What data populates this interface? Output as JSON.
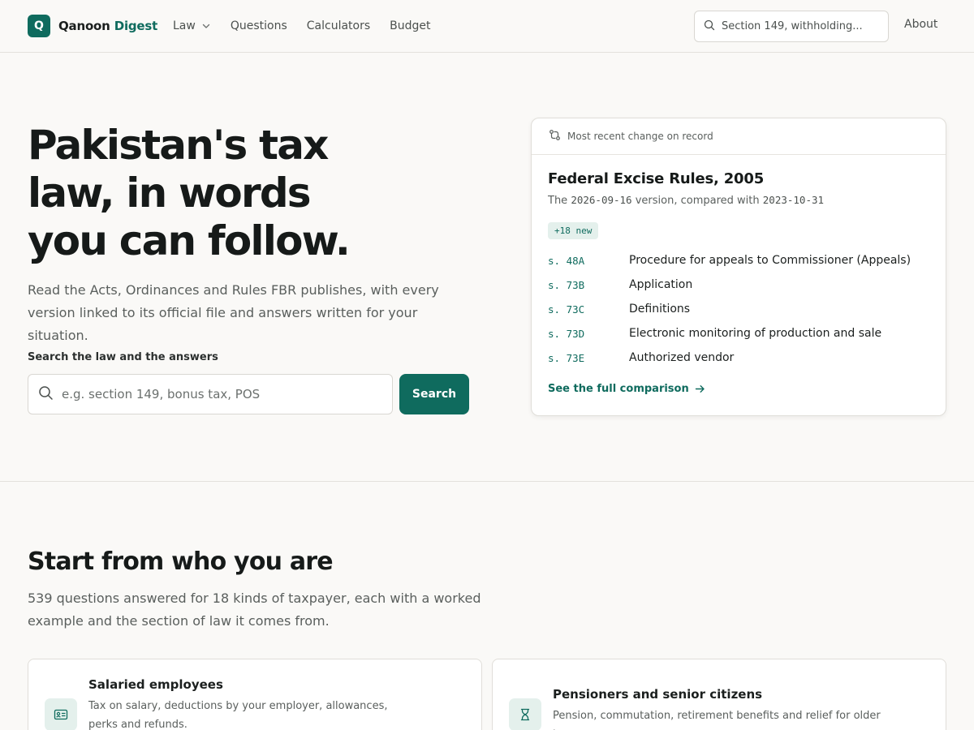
{
  "header": {
    "logo_mark": "Q",
    "logo_word_1": "Qanoon",
    "logo_word_2": "Digest",
    "nav": [
      {
        "label": "Law",
        "has_dropdown": true
      },
      {
        "label": "Questions"
      },
      {
        "label": "Calculators"
      },
      {
        "label": "Budget"
      }
    ],
    "search_placeholder": "Section 149, withholding...",
    "about_label": "About"
  },
  "hero": {
    "title_line_1": "Pakistan's tax",
    "title_line_2": "law, in words",
    "title_line_3": "you can follow.",
    "lead": "Read the Acts, Ordinances and Rules FBR publishes, with every version linked to its official file and answers written for your situation.",
    "search_label": "Search the law and the answers",
    "search_placeholder": "e.g. section 149, bonus tax, POS",
    "search_button": "Search"
  },
  "change_card": {
    "header_label": "Most recent change on record",
    "title": "Federal Excise Rules, 2005",
    "subtitle_prefix": "The",
    "version_new": "2026-09-16",
    "subtitle_middle": "version, compared with",
    "version_old": "2023-10-31",
    "badge": "+18 new",
    "sections": [
      {
        "num": "s. 48A",
        "title": "Procedure for appeals to Commissioner (Appeals)"
      },
      {
        "num": "s. 73B",
        "title": "Application"
      },
      {
        "num": "s. 73C",
        "title": "Definitions"
      },
      {
        "num": "s. 73D",
        "title": "Electronic monitoring of production and sale"
      },
      {
        "num": "s. 73E",
        "title": "Authorized vendor"
      }
    ],
    "link_label": "See the full comparison"
  },
  "audience": {
    "title": "Start from who you are",
    "lead": "539 questions answered for 18 kinds of taxpayer, each with a worked example and the section of law it comes from.",
    "cards": [
      {
        "title": "Salaried employees",
        "description": "Tax on salary, deductions by your employer, allowances, perks and refunds.",
        "icon": "id-card-icon"
      },
      {
        "title": "Pensioners and senior citizens",
        "description": "Pension, commutation, retirement benefits and relief for older taxpayers.",
        "icon": "hourglass-icon"
      }
    ]
  },
  "colors": {
    "accent": "#0f6b5e",
    "accent_soft": "#e4f0ec",
    "background": "#faf9f7",
    "text": "#1b1f1e",
    "muted": "#5a5f5d"
  }
}
